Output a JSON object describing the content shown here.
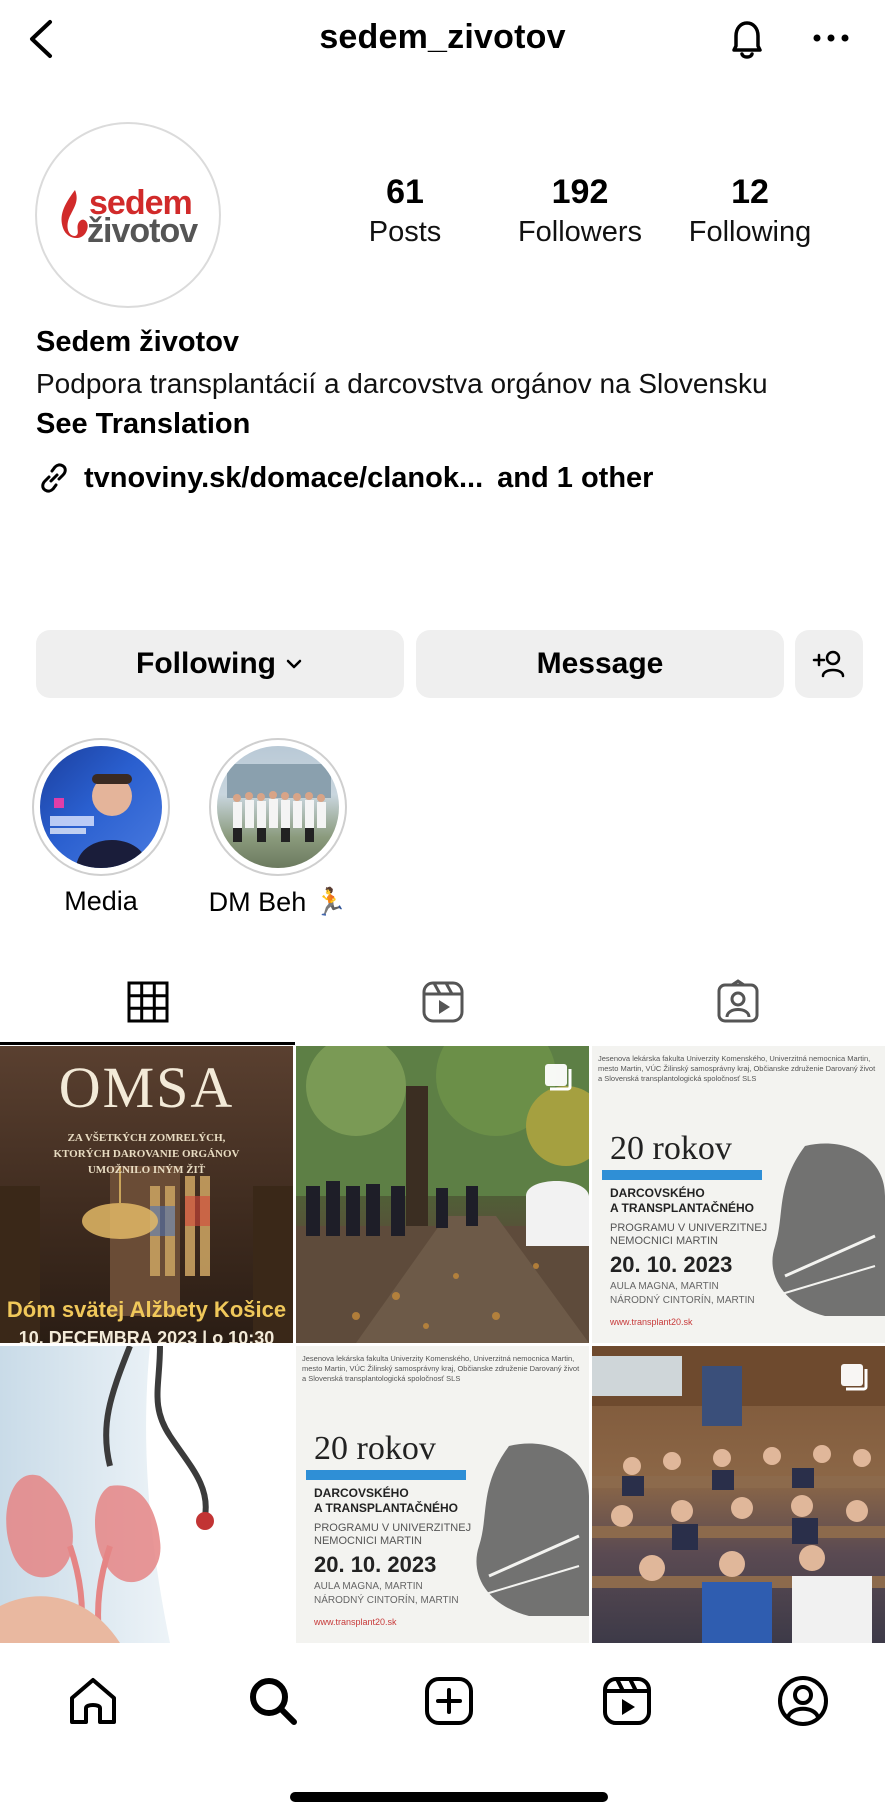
{
  "header": {
    "username": "sedem_zivotov"
  },
  "profile": {
    "logo_top": "sedem",
    "logo_bottom": "životov",
    "stats": [
      {
        "value": "61",
        "label": "Posts"
      },
      {
        "value": "192",
        "label": "Followers"
      },
      {
        "value": "12",
        "label": "Following"
      }
    ],
    "name": "Sedem životov",
    "bio": "Podpora transplantácií a darcovstva orgánov na Slovensku",
    "see_translation": "See Translation",
    "link": "tvnoviny.sk/domace/clanok...",
    "link_other": "and 1 other"
  },
  "actions": {
    "following_label": "Following",
    "message_label": "Message"
  },
  "highlights": [
    {
      "label": "Media"
    },
    {
      "label": "DM Beh 🏃"
    }
  ],
  "posts": {
    "omsa": {
      "title": "OMSA",
      "subtitle_1": "ZA VŠETKÝCH ZOMRELÝCH,",
      "subtitle_2": "KTORÝCH DAROVANIE ORGÁNOV",
      "subtitle_3": "UMOŽNILO INÝM ŽIŤ",
      "place": "Dóm svätej Alžbety Košice",
      "date": "10. DECEMBRA 2023 | o 10:30"
    },
    "poster": {
      "header": "Jesenova lekárska fakulta Univerzity Komenského, Univerzitná nemocnica Martin, mesto Martin, VÚC Žilinský samosprávny kraj, Občianske združenie Darovaný život a Slovenská transplantologická spoločnosť SLS",
      "title": "20 rokov",
      "line1": "DARCOVSKÉHO",
      "line2": "A TRANSPLANTAČNÉHO",
      "line3": "PROGRAMU V UNIVERZITNEJ",
      "line4": "NEMOCNICI MARTIN",
      "date": "20. 10. 2023",
      "venue1": "AULA MAGNA, MARTIN",
      "venue2": "NÁRODNÝ CINTORÍN, MARTIN",
      "url": "www.transplant20.sk"
    }
  },
  "colors": {
    "accent_red": "#d12a2a",
    "button_bg": "#efefef",
    "poster_blue": "#2f8fd6"
  }
}
